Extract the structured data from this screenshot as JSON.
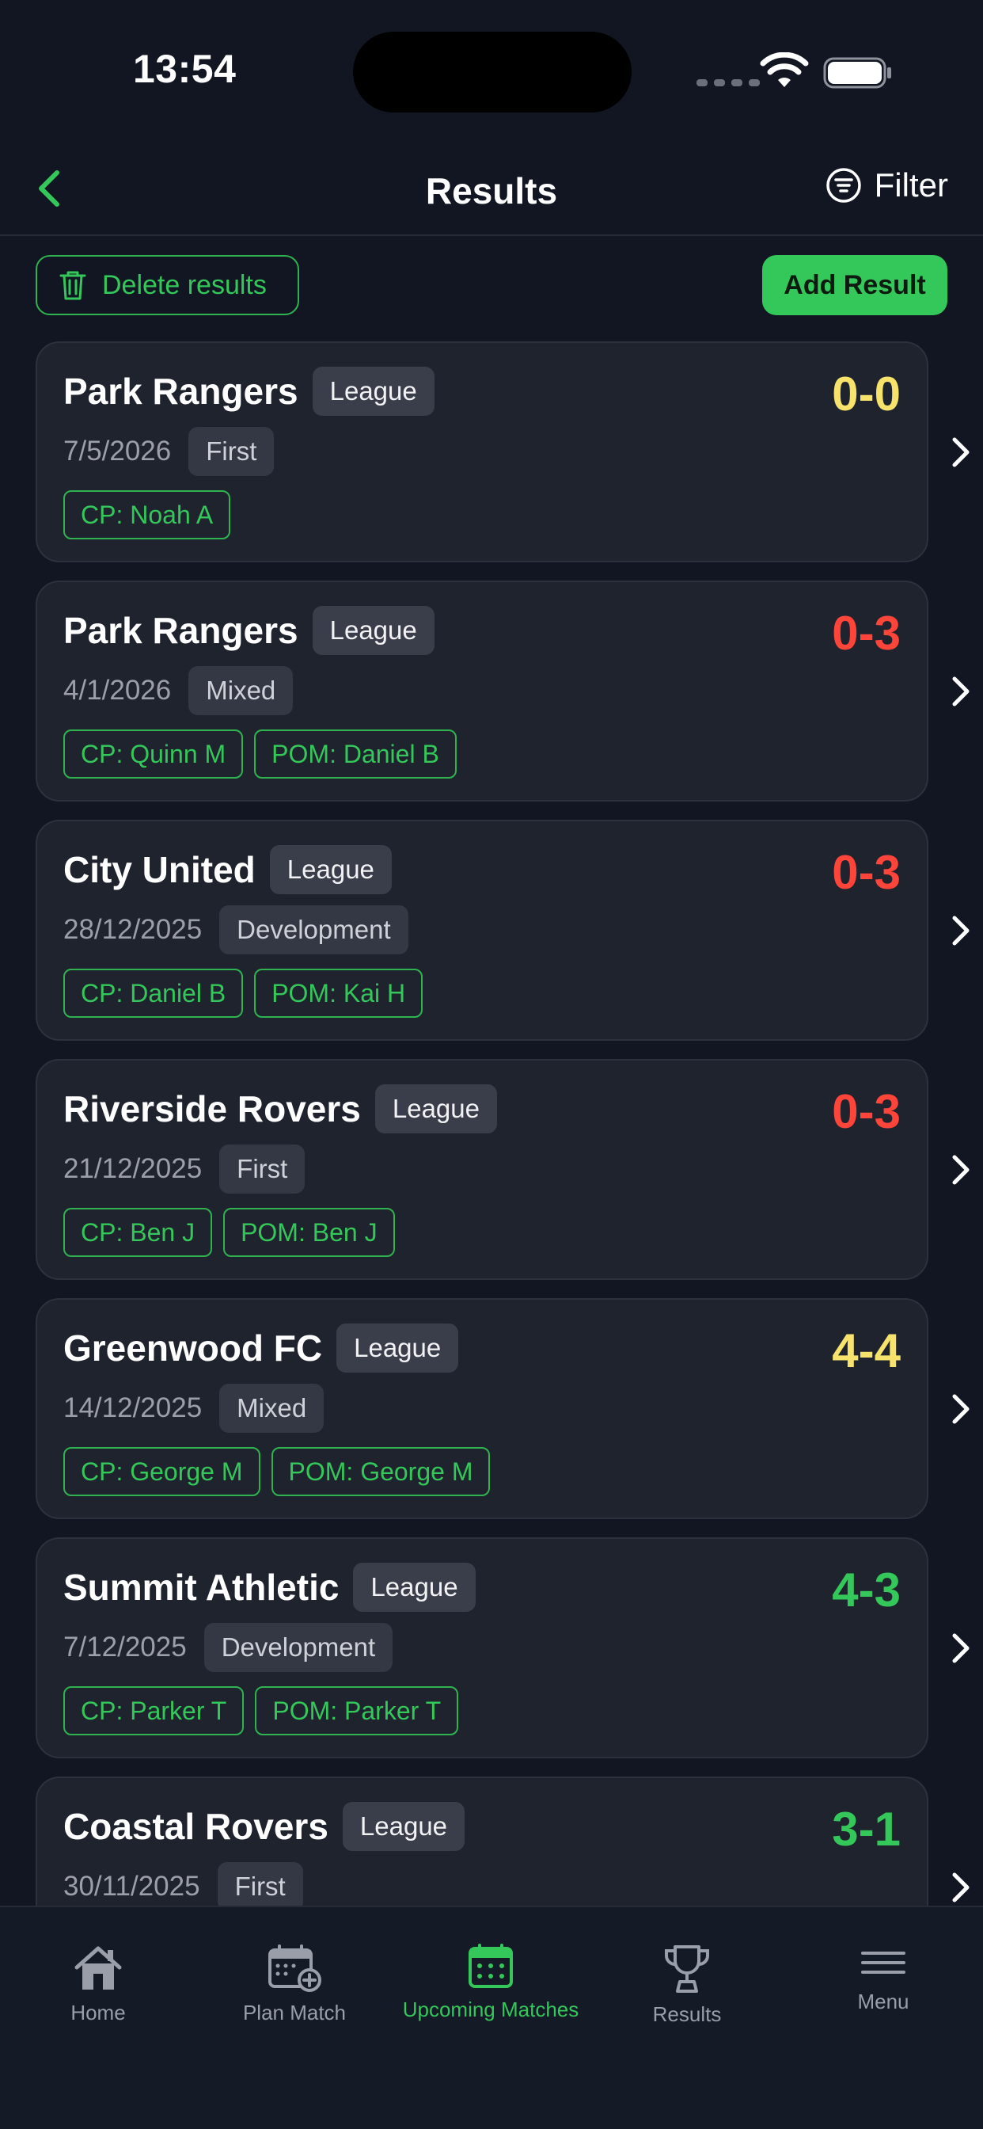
{
  "status": {
    "time": "13:54"
  },
  "nav": {
    "title": "Results",
    "filter_label": "Filter"
  },
  "actions": {
    "delete_label": "Delete results",
    "add_label": "Add Result"
  },
  "colors": {
    "accent": "#34c759",
    "draw": "#f7e36b",
    "loss": "#ff453a",
    "win": "#34c759"
  },
  "results": [
    {
      "team": "Park Rangers",
      "competition": "League",
      "date": "7/5/2026",
      "squad": "First",
      "tags": [
        "CP: Noah A"
      ],
      "score": "0-0",
      "outcome": "draw"
    },
    {
      "team": "Park Rangers",
      "competition": "League",
      "date": "4/1/2026",
      "squad": "Mixed",
      "tags": [
        "CP: Quinn M",
        "POM: Daniel B"
      ],
      "score": "0-3",
      "outcome": "loss"
    },
    {
      "team": "City United",
      "competition": "League",
      "date": "28/12/2025",
      "squad": "Development",
      "tags": [
        "CP: Daniel B",
        "POM: Kai H"
      ],
      "score": "0-3",
      "outcome": "loss"
    },
    {
      "team": "Riverside Rovers",
      "competition": "League",
      "date": "21/12/2025",
      "squad": "First",
      "tags": [
        "CP: Ben J",
        "POM: Ben J"
      ],
      "score": "0-3",
      "outcome": "loss"
    },
    {
      "team": "Greenwood FC",
      "competition": "League",
      "date": "14/12/2025",
      "squad": "Mixed",
      "tags": [
        "CP: George M",
        "POM: George M"
      ],
      "score": "4-4",
      "outcome": "draw"
    },
    {
      "team": "Summit Athletic",
      "competition": "League",
      "date": "7/12/2025",
      "squad": "Development",
      "tags": [
        "CP: Parker T",
        "POM: Parker T"
      ],
      "score": "4-3",
      "outcome": "win"
    },
    {
      "team": "Coastal Rovers",
      "competition": "League",
      "date": "30/11/2025",
      "squad": "First",
      "tags": [],
      "score": "3-1",
      "outcome": "win"
    }
  ],
  "tabs": [
    {
      "label": "Home",
      "icon": "home-icon",
      "active": false
    },
    {
      "label": "Plan Match",
      "icon": "calendar-plus-icon",
      "active": false
    },
    {
      "label": "Upcoming Matches",
      "icon": "calendar-icon",
      "active": true
    },
    {
      "label": "Results",
      "icon": "trophy-icon",
      "active": false
    },
    {
      "label": "Menu",
      "icon": "menu-icon",
      "active": false
    }
  ]
}
